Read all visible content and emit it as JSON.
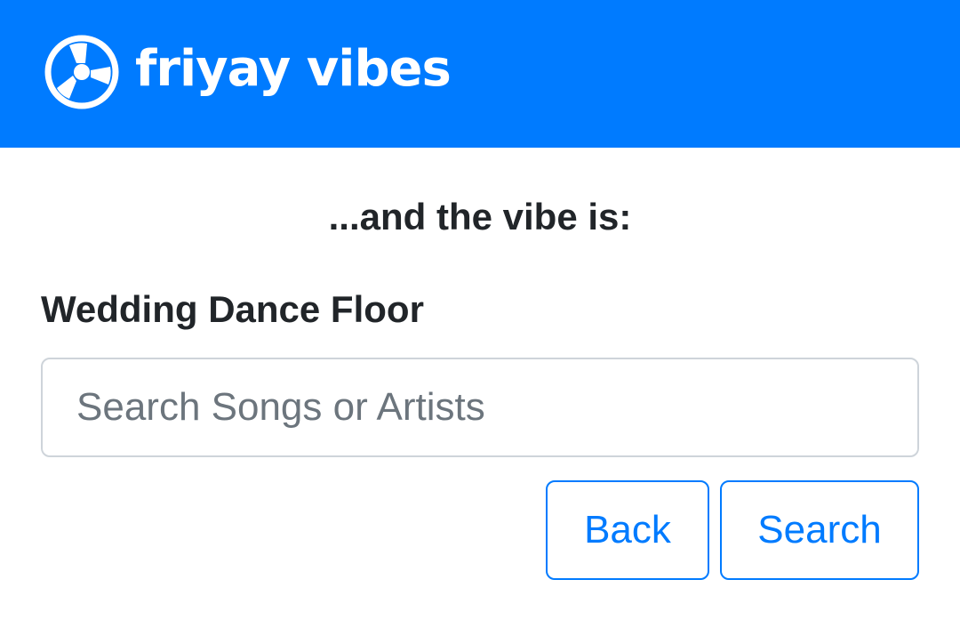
{
  "navbar": {
    "brand_name": "friyay vibes",
    "logo_icon": "fan-icon",
    "background_color": "#007bff"
  },
  "main": {
    "prompt": "...and the vibe is:",
    "vibe_name": "Wedding Dance Floor",
    "search": {
      "value": "",
      "placeholder": "Search Songs or Artists"
    },
    "buttons": {
      "back_label": "Back",
      "search_label": "Search",
      "accent_color": "#007bff"
    }
  }
}
